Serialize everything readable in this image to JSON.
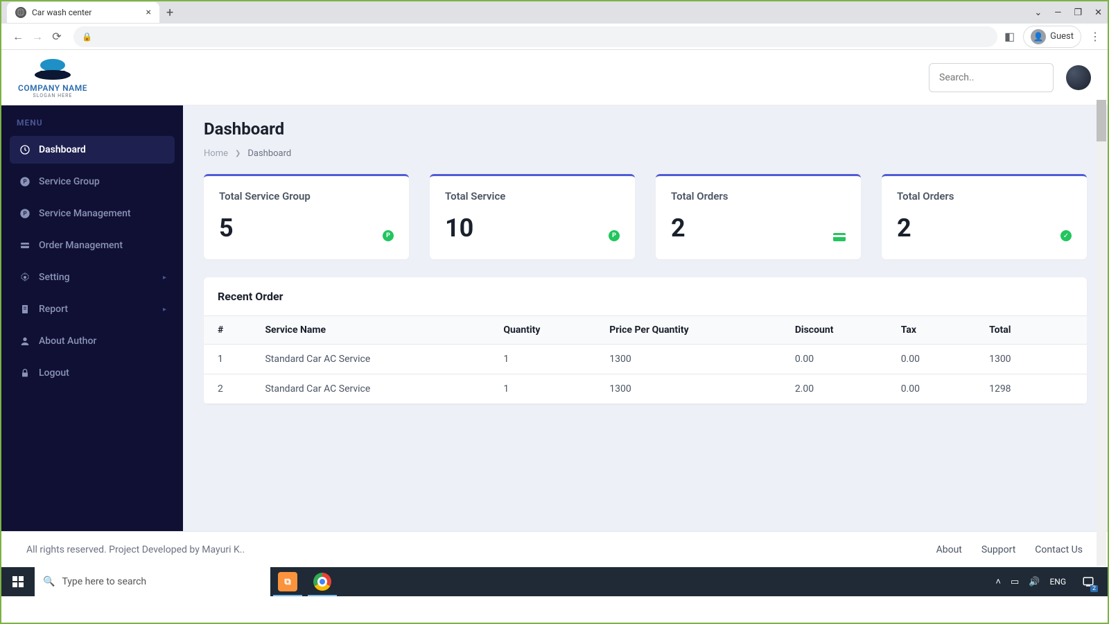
{
  "browser": {
    "tab_title": "Car wash center",
    "guest_label": "Guest"
  },
  "logo": {
    "name": "COMPANY NAME",
    "slogan": "SLOGAN HERE"
  },
  "search": {
    "placeholder": "Search.."
  },
  "sidebar": {
    "label": "MENU",
    "items": [
      {
        "label": "Dashboard"
      },
      {
        "label": "Service Group"
      },
      {
        "label": "Service Management"
      },
      {
        "label": "Order Management"
      },
      {
        "label": "Setting"
      },
      {
        "label": "Report"
      },
      {
        "label": "About Author"
      },
      {
        "label": "Logout"
      }
    ]
  },
  "page": {
    "title": "Dashboard",
    "breadcrumb": {
      "home": "Home",
      "current": "Dashboard"
    }
  },
  "cards": [
    {
      "title": "Total Service Group",
      "value": "5"
    },
    {
      "title": "Total Service",
      "value": "10"
    },
    {
      "title": "Total Orders",
      "value": "2"
    },
    {
      "title": "Total Orders",
      "value": "2"
    }
  ],
  "table": {
    "title": "Recent Order",
    "headers": {
      "idx": "#",
      "name": "Service Name",
      "qty": "Quantity",
      "price": "Price Per Quantity",
      "discount": "Discount",
      "tax": "Tax",
      "total": "Total"
    },
    "rows": [
      {
        "idx": "1",
        "name": "Standard Car AC Service",
        "qty": "1",
        "price": "1300",
        "discount": "0.00",
        "tax": "0.00",
        "total": "1300"
      },
      {
        "idx": "2",
        "name": "Standard Car AC Service",
        "qty": "1",
        "price": "1300",
        "discount": "2.00",
        "tax": "0.00",
        "total": "1298"
      }
    ]
  },
  "footer": {
    "text": "All rights reserved. Project Developed by Mayuri K..",
    "links": {
      "about": "About",
      "support": "Support",
      "contact": "Contact Us"
    }
  },
  "taskbar": {
    "search_placeholder": "Type here to search",
    "lang": "ENG",
    "notif_count": "2"
  }
}
